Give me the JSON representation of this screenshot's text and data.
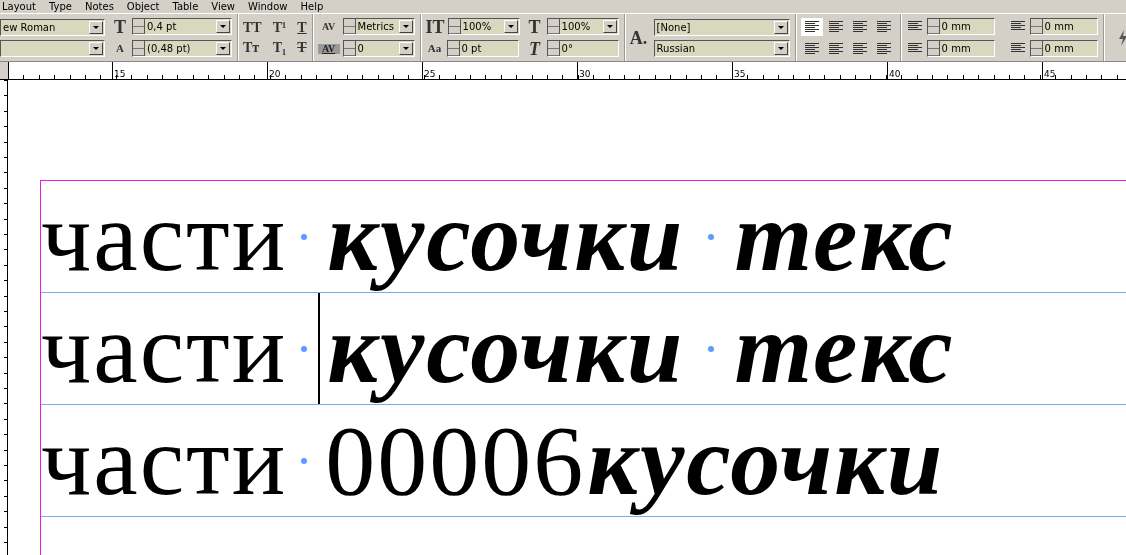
{
  "menu": [
    "Layout",
    "Type",
    "Notes",
    "Object",
    "Table",
    "View",
    "Window",
    "Help"
  ],
  "toolbar": {
    "font_family": "ew Roman",
    "font_size_glyph": "T",
    "font_size": "0,4 pt",
    "leading_glyph": "A",
    "leading": "(0,48 pt)",
    "case_buttons": [
      "TT",
      "T¹",
      "T",
      "Tт",
      "T₁",
      "T"
    ],
    "kerning_glyph": "AV",
    "kerning": "Metrics",
    "tracking_glyph": "AV",
    "tracking": "0",
    "vertical_scale_glyph": "IT",
    "vertical_scale": "100%",
    "baseline_shift_glyph": "Aa",
    "baseline_shift": "0 pt",
    "horizontal_scale_glyph": "T",
    "horizontal_scale": "100%",
    "skew_glyph": "T",
    "skew": "0°",
    "character_style_glyph": "A.",
    "character_style": "[None]",
    "language": "Russian",
    "alignments": [
      {
        "selected": true
      },
      {
        "selected": false
      },
      {
        "selected": false
      },
      {
        "selected": false
      },
      {
        "selected": false
      },
      {
        "selected": false
      },
      {
        "selected": false
      },
      {
        "selected": false
      }
    ],
    "indents": [
      "0 mm",
      "0 mm",
      "0 mm",
      "0 mm"
    ]
  },
  "ruler": [
    "15",
    "20",
    "25",
    "30",
    "35",
    "40",
    "45"
  ],
  "lines": [
    {
      "runs": [
        {
          "kind": "plain",
          "text": "части"
        },
        {
          "kind": "space",
          "caret": false
        },
        {
          "kind": "emphasis",
          "text": "кусочки"
        },
        {
          "kind": "space",
          "caret": false
        },
        {
          "kind": "emphasis",
          "text": "текс"
        }
      ]
    },
    {
      "runs": [
        {
          "kind": "plain",
          "text": "части"
        },
        {
          "kind": "space",
          "caret": true
        },
        {
          "kind": "emphasis",
          "text": "кусочки"
        },
        {
          "kind": "space",
          "caret": false
        },
        {
          "kind": "emphasis",
          "text": "текс"
        }
      ]
    },
    {
      "runs": [
        {
          "kind": "plain",
          "text": "части"
        },
        {
          "kind": "space",
          "caret": false
        },
        {
          "kind": "plain",
          "text": "00006"
        },
        {
          "kind": "emphasis",
          "text": "кусочки"
        }
      ]
    }
  ]
}
